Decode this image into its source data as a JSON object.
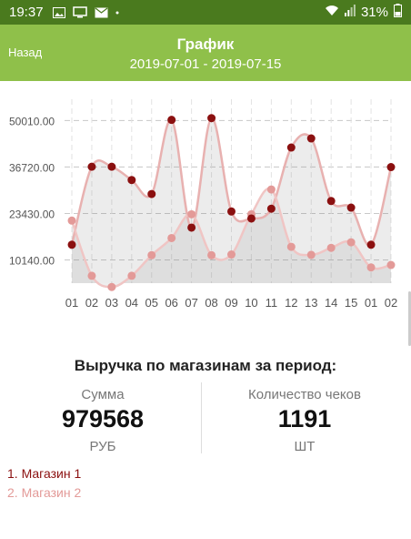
{
  "status_bar": {
    "time": "19:37",
    "battery": "31%",
    "icons": [
      "image-icon",
      "monitor-icon",
      "mail-icon",
      "dot-icon",
      "wifi-icon",
      "signal-icon",
      "battery-icon"
    ]
  },
  "header": {
    "back_label": "Назад",
    "title": "График",
    "subtitle": "2019-07-01 - 2019-07-15",
    "background_color": "#8fc04a",
    "status_bar_color": "#4a7a1e"
  },
  "chart_data": {
    "type": "line",
    "categories": [
      "01",
      "02",
      "03",
      "04",
      "05",
      "06",
      "07",
      "08",
      "09",
      "10",
      "11",
      "12",
      "13",
      "14",
      "15",
      "01",
      "02"
    ],
    "series": [
      {
        "name": "1. Магазин 1",
        "color": "#8b1010",
        "values": [
          14500,
          36800,
          36800,
          33000,
          29000,
          50200,
          19400,
          50700,
          24000,
          22000,
          24800,
          42300,
          44900,
          27000,
          25100,
          14500,
          36700
        ]
      },
      {
        "name": "2. Магазин 2",
        "color": "#e39a98",
        "values": [
          21400,
          5600,
          2400,
          5600,
          11500,
          16400,
          23200,
          11500,
          11700,
          23200,
          30300,
          13900,
          11600,
          13600,
          15200,
          8000,
          8700
        ]
      }
    ],
    "y_ticks": [
      "10140.00",
      "23430.00",
      "36720.00",
      "50010.00"
    ],
    "y_tick_values": [
      10140,
      23430,
      36720,
      50010
    ],
    "ylim": [
      3500,
      53500
    ],
    "grid": true,
    "area_fill": true
  },
  "summary": {
    "title": "Выручка по магазинам за период:",
    "sum_label": "Сумма",
    "sum_value": "979568",
    "sum_unit": "РУБ",
    "checks_label": "Количество чеков",
    "checks_value": "1191",
    "checks_unit": "ШТ"
  },
  "legend": {
    "item1": "1. Магазин 1",
    "item2": "2. Магазин 2"
  }
}
